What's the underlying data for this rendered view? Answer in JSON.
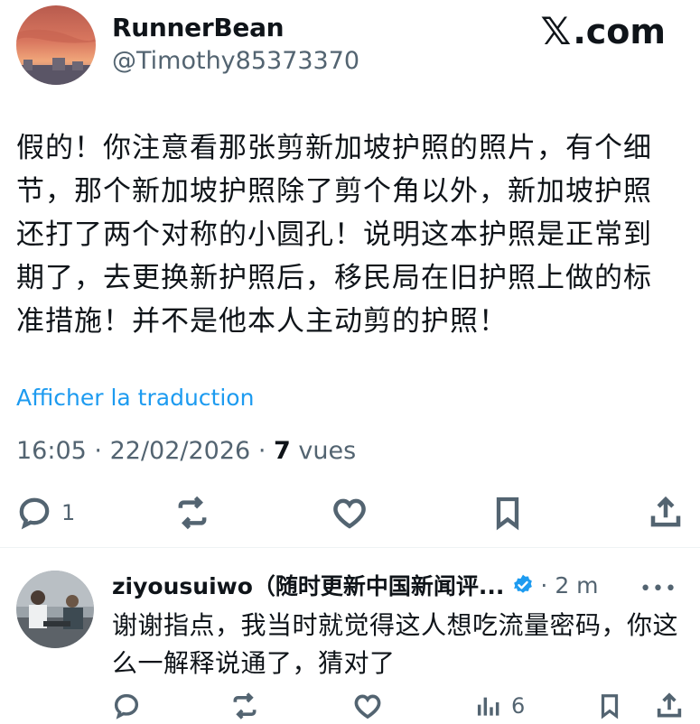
{
  "author": {
    "name": "RunnerBean",
    "handle": "@Timothy85373370"
  },
  "brand": {
    "text": ".com",
    "logo_icon": "x-logo-icon"
  },
  "post": {
    "text": "假的！你注意看那张剪新加坡护照的照片，有个细节，那个新加坡护照除了剪个角以外，新加坡护照还打了两个对称的小圆孔！说明这本护照是正常到期了，去更换新护照后，移民局在旧护照上做的标准措施！并不是他本人主动剪的护照！",
    "translate_link": "Afficher la traduction",
    "time": "16:05",
    "date": "22/02/2026",
    "views_count": "7",
    "views_label": "vues",
    "reply_count": "1"
  },
  "reply": {
    "name": "ziyousuiwo（随时更新中国新闻评...",
    "time": "2 m",
    "more": "•••",
    "text": "谢谢指点，我当时就觉得这人想吃流量密码，你这么一解释说通了，猜对了",
    "views_count": "6"
  },
  "colors": {
    "link": "#1d9bf0",
    "secondary": "#536471",
    "text": "#0f1419",
    "verified": "#1d9bf0"
  }
}
